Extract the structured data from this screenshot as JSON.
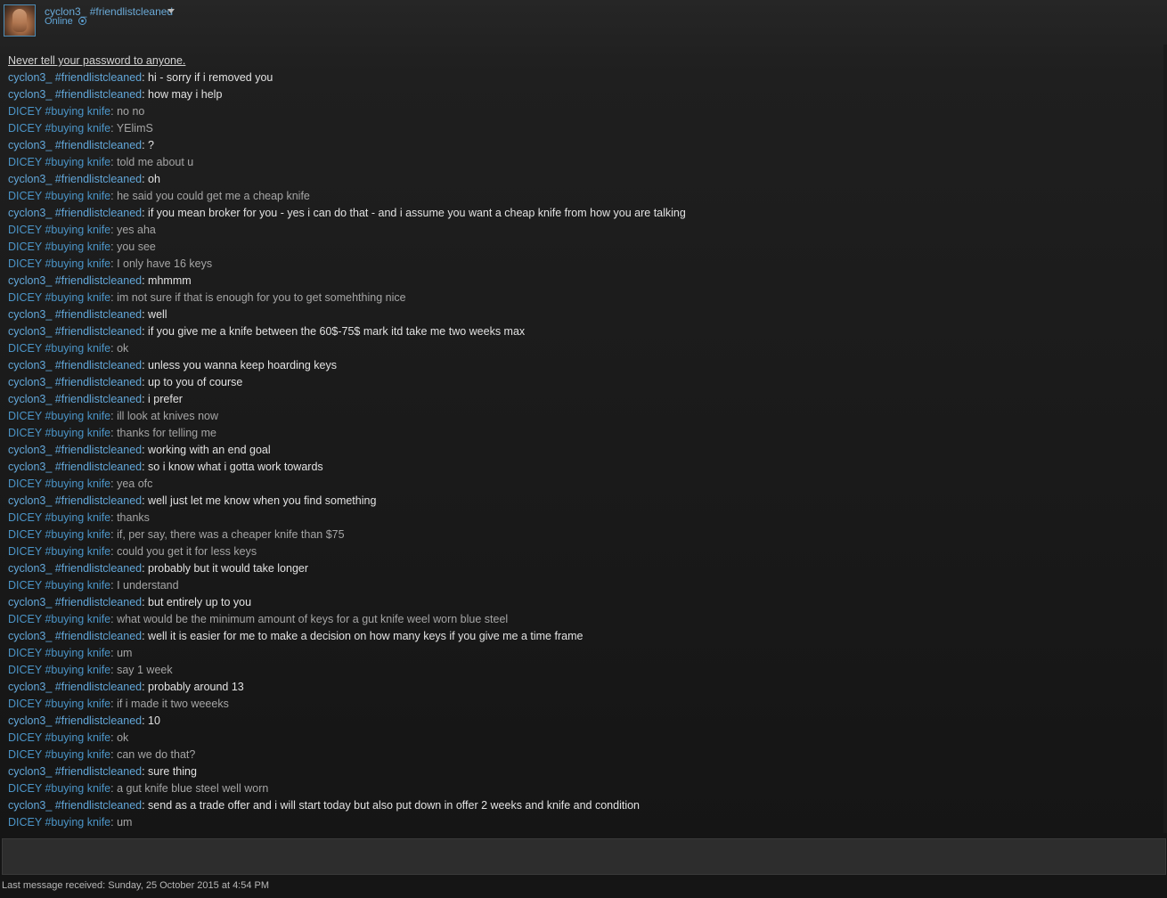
{
  "header": {
    "username": "cyclon3_ #friendlistcleaned",
    "status": "Online",
    "avatar_icon": "user-avatar",
    "dropdown_icon": "caret-down",
    "status_icon": "online-status-icon"
  },
  "chat": {
    "warning": "Never tell your password to anyone.",
    "messages": [
      {
        "sender": "cyclon3_ #friendlistcleaned",
        "text": ": hi - sorry if i removed you",
        "me": true
      },
      {
        "sender": "cyclon3_ #friendlistcleaned",
        "text": ": how may i help",
        "me": true
      },
      {
        "sender": "DICEY #buying knife",
        "text": ": no no",
        "me": false
      },
      {
        "sender": "DICEY #buying knife",
        "text": ": YElimS",
        "me": false
      },
      {
        "sender": "cyclon3_ #friendlistcleaned",
        "text": ": ?",
        "me": true
      },
      {
        "sender": "DICEY #buying knife",
        "text": ": told me about u",
        "me": false
      },
      {
        "sender": "cyclon3_ #friendlistcleaned",
        "text": ": oh",
        "me": true
      },
      {
        "sender": "DICEY #buying knife",
        "text": ": he said you could get me a cheap knife",
        "me": false
      },
      {
        "sender": "cyclon3_ #friendlistcleaned",
        "text": ": if you mean broker for you - yes i can do that - and i assume you want a cheap knife from how you are talking",
        "me": true
      },
      {
        "sender": "DICEY #buying knife",
        "text": ": yes aha",
        "me": false
      },
      {
        "sender": "DICEY #buying knife",
        "text": ": you see",
        "me": false
      },
      {
        "sender": "DICEY #buying knife",
        "text": ": I only have 16 keys",
        "me": false
      },
      {
        "sender": "cyclon3_ #friendlistcleaned",
        "text": ": mhmmm",
        "me": true
      },
      {
        "sender": "DICEY #buying knife",
        "text": ": im not sure if that is enough for you to get somehthing nice",
        "me": false
      },
      {
        "sender": "cyclon3_ #friendlistcleaned",
        "text": ": well",
        "me": true
      },
      {
        "sender": "cyclon3_ #friendlistcleaned",
        "text": ": if you give me a knife between the 60$-75$ mark itd take me two weeks max",
        "me": true
      },
      {
        "sender": "DICEY #buying knife",
        "text": ": ok",
        "me": false
      },
      {
        "sender": "cyclon3_ #friendlistcleaned",
        "text": ": unless you wanna keep hoarding keys",
        "me": true
      },
      {
        "sender": "cyclon3_ #friendlistcleaned",
        "text": ": up to you of course",
        "me": true
      },
      {
        "sender": "cyclon3_ #friendlistcleaned",
        "text": ": i prefer",
        "me": true
      },
      {
        "sender": "DICEY #buying knife",
        "text": ": ill look at knives now",
        "me": false
      },
      {
        "sender": "DICEY #buying knife",
        "text": ": thanks for telling me",
        "me": false
      },
      {
        "sender": "cyclon3_ #friendlistcleaned",
        "text": ": working with an end goal",
        "me": true
      },
      {
        "sender": "cyclon3_ #friendlistcleaned",
        "text": ": so i know what i gotta work towards",
        "me": true
      },
      {
        "sender": "DICEY #buying knife",
        "text": ": yea ofc",
        "me": false
      },
      {
        "sender": "cyclon3_ #friendlistcleaned",
        "text": ": well just let me know when you find something",
        "me": true
      },
      {
        "sender": "DICEY #buying knife",
        "text": ": thanks",
        "me": false
      },
      {
        "sender": "DICEY #buying knife",
        "text": ": if, per say, there was a cheaper knife than $75",
        "me": false
      },
      {
        "sender": "DICEY #buying knife",
        "text": ": could you get it for less keys",
        "me": false
      },
      {
        "sender": "cyclon3_ #friendlistcleaned",
        "text": ": probably but it would take longer",
        "me": true
      },
      {
        "sender": "DICEY #buying knife",
        "text": ": I understand",
        "me": false
      },
      {
        "sender": "cyclon3_ #friendlistcleaned",
        "text": ": but entirely up to you",
        "me": true
      },
      {
        "sender": "DICEY #buying knife",
        "text": ": what would be the minimum amount of keys for a gut knife weel worn blue steel",
        "me": false
      },
      {
        "sender": "cyclon3_ #friendlistcleaned",
        "text": ": well it is easier for me to make a decision on how many keys if you give me a time frame",
        "me": true
      },
      {
        "sender": "DICEY #buying knife",
        "text": ": um",
        "me": false
      },
      {
        "sender": "DICEY #buying knife",
        "text": ": say 1 week",
        "me": false
      },
      {
        "sender": "cyclon3_ #friendlistcleaned",
        "text": ": probably around 13",
        "me": true
      },
      {
        "sender": "DICEY #buying knife",
        "text": ": if i made it two weeeks",
        "me": false
      },
      {
        "sender": "cyclon3_ #friendlistcleaned",
        "text": ": 10",
        "me": true
      },
      {
        "sender": "DICEY #buying knife",
        "text": ": ok",
        "me": false
      },
      {
        "sender": "DICEY #buying knife",
        "text": ": can we do that?",
        "me": false
      },
      {
        "sender": "cyclon3_ #friendlistcleaned",
        "text": ": sure thing",
        "me": true
      },
      {
        "sender": "DICEY #buying knife",
        "text": ": a gut knife blue steel well worn",
        "me": false
      },
      {
        "sender": "cyclon3_ #friendlistcleaned",
        "text": ": send as a trade offer and i will start today but also put down in offer 2 weeks and knife and condition",
        "me": true
      },
      {
        "sender": "DICEY #buying knife",
        "text": ": um",
        "me": false
      }
    ]
  },
  "input": {
    "value": ""
  },
  "footer": {
    "last_message": "Last message received: Sunday, 25 October 2015 at 4:54 PM"
  }
}
